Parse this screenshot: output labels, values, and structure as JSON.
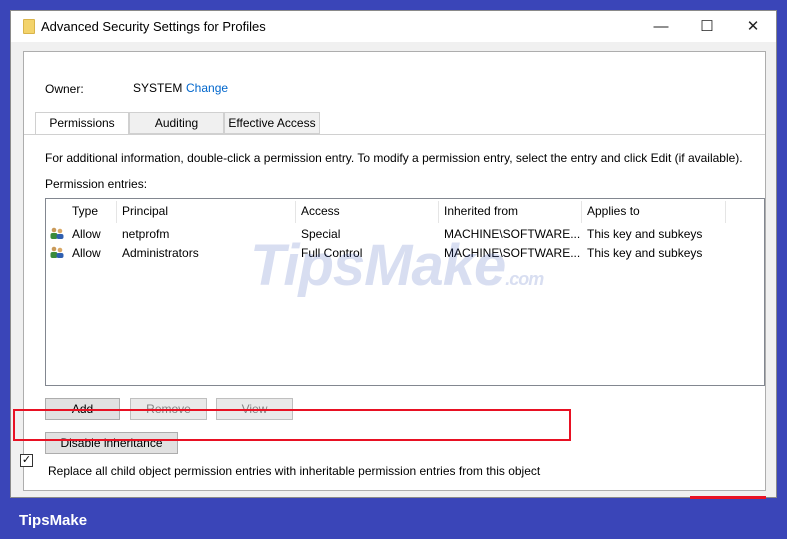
{
  "window": {
    "title": "Advanced Security Settings for Profiles",
    "minimize": "—",
    "maximize": "☐",
    "close": "✕"
  },
  "owner": {
    "label": "Owner:",
    "value": "SYSTEM",
    "change_link": "Change"
  },
  "tabs": [
    {
      "label": "Permissions",
      "active": true
    },
    {
      "label": "Auditing"
    },
    {
      "label": "Effective Access"
    }
  ],
  "info_text": "For additional information, double-click a permission entry. To modify a permission entry, select the entry and click Edit (if available).",
  "entries_label": "Permission entries:",
  "columns": [
    "Type",
    "Principal",
    "Access",
    "Inherited from",
    "Applies to"
  ],
  "rows": [
    [
      "Allow",
      "netprofm",
      "Special",
      "MACHINE\\SOFTWARE...",
      "This key and subkeys"
    ],
    [
      "Allow",
      "Administrators",
      "Full Control",
      "MACHINE\\SOFTWARE...",
      "This key and subkeys"
    ]
  ],
  "buttons": {
    "add": "Add",
    "remove": "Remove",
    "view": "View",
    "disable_inheritance": "Disable inheritance"
  },
  "replace_checkbox": {
    "label": "Replace all child object permission entries with inheritable permission entries from this object",
    "checked": true
  },
  "watermark": "TipsMake",
  "watermark_suffix": ".com",
  "brand": "TipsMake"
}
